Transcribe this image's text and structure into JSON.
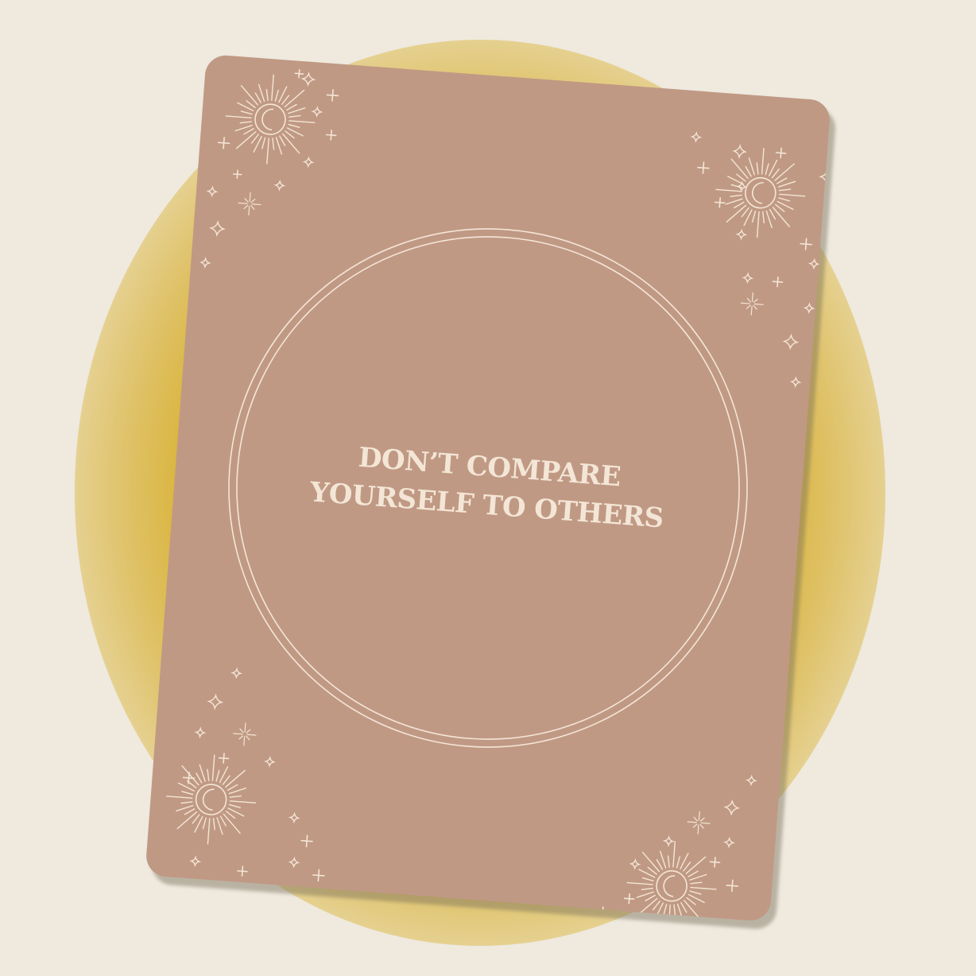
{
  "card": {
    "quote_line_1": "DON’T COMPARE",
    "quote_line_2": "YOURSELF TO OTHERS"
  },
  "colors": {
    "background": "#efe9de",
    "glow": "#d6af2f",
    "card": "#c09984",
    "line_art": "#f3e6d6"
  },
  "icons": [
    "sun-moon-icon",
    "sparkle-icon",
    "plus-star-icon",
    "starburst-icon"
  ]
}
